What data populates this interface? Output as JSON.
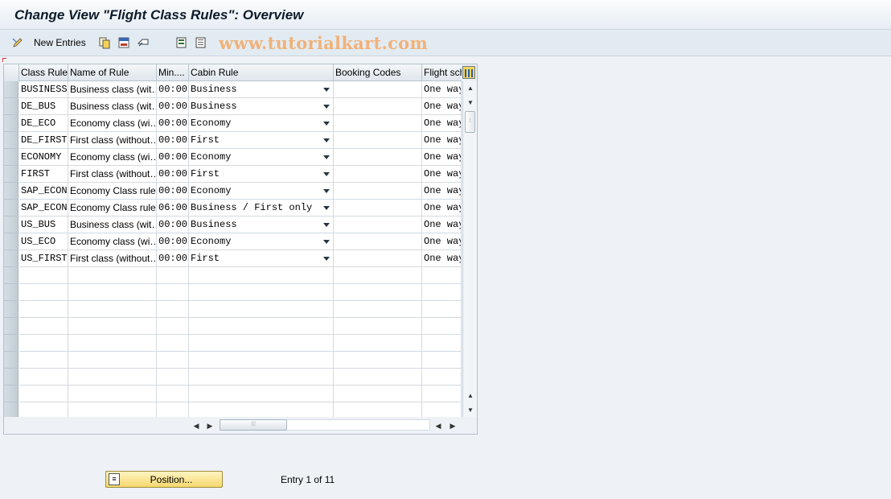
{
  "window": {
    "title": "Change View \"Flight Class Rules\": Overview"
  },
  "toolbar": {
    "new_entries_label": "New Entries",
    "icons": [
      "edit-pencil-icon",
      "copy-icon",
      "delete-icon",
      "undo-icon",
      "select-all-icon",
      "deselect-all-icon"
    ]
  },
  "watermark": "www.tutorialkart.com",
  "table": {
    "headers": [
      "Class Rule",
      "Name of Rule",
      "Min....",
      "Cabin Rule",
      "Booking Codes",
      "Flight sch"
    ],
    "rows": [
      {
        "class_rule": "BUSINESS",
        "name": "Business class (wit…",
        "min": "00:00",
        "cabin": "Business",
        "booking": "",
        "flight": "One way"
      },
      {
        "class_rule": "DE_BUS",
        "name": "Business class (wit…",
        "min": "00:00",
        "cabin": "Business",
        "booking": "",
        "flight": "One way"
      },
      {
        "class_rule": "DE_ECO",
        "name": "Economy class (wi…",
        "min": "00:00",
        "cabin": "Economy",
        "booking": "",
        "flight": "One way"
      },
      {
        "class_rule": "DE_FIRST",
        "name": "First class (without…",
        "min": "00:00",
        "cabin": "First",
        "booking": "",
        "flight": "One way"
      },
      {
        "class_rule": "ECONOMY",
        "name": "Economy class (wi…",
        "min": "00:00",
        "cabin": "Economy",
        "booking": "",
        "flight": "One way"
      },
      {
        "class_rule": "FIRST",
        "name": "First class (without…",
        "min": "00:00",
        "cabin": "First",
        "booking": "",
        "flight": "One way"
      },
      {
        "class_rule": "SAP_ECON",
        "name": "Economy Class rules",
        "min": "00:00",
        "cabin": "Economy",
        "booking": "",
        "flight": "One way"
      },
      {
        "class_rule": "SAP_ECON",
        "name": "Economy Class rules",
        "min": "06:00",
        "cabin": "Business / First only",
        "booking": "",
        "flight": "One way"
      },
      {
        "class_rule": "US_BUS",
        "name": "Business class (wit…",
        "min": "00:00",
        "cabin": "Business",
        "booking": "",
        "flight": "One way"
      },
      {
        "class_rule": "US_ECO",
        "name": "Economy class (wi…",
        "min": "00:00",
        "cabin": "Economy",
        "booking": "",
        "flight": "One way"
      },
      {
        "class_rule": "US_FIRST",
        "name": "First class (without…",
        "min": "00:00",
        "cabin": "First",
        "booking": "",
        "flight": "One way"
      }
    ],
    "empty_rows": 9
  },
  "footer": {
    "position_button": "Position...",
    "entry_info": "Entry 1 of 11"
  }
}
